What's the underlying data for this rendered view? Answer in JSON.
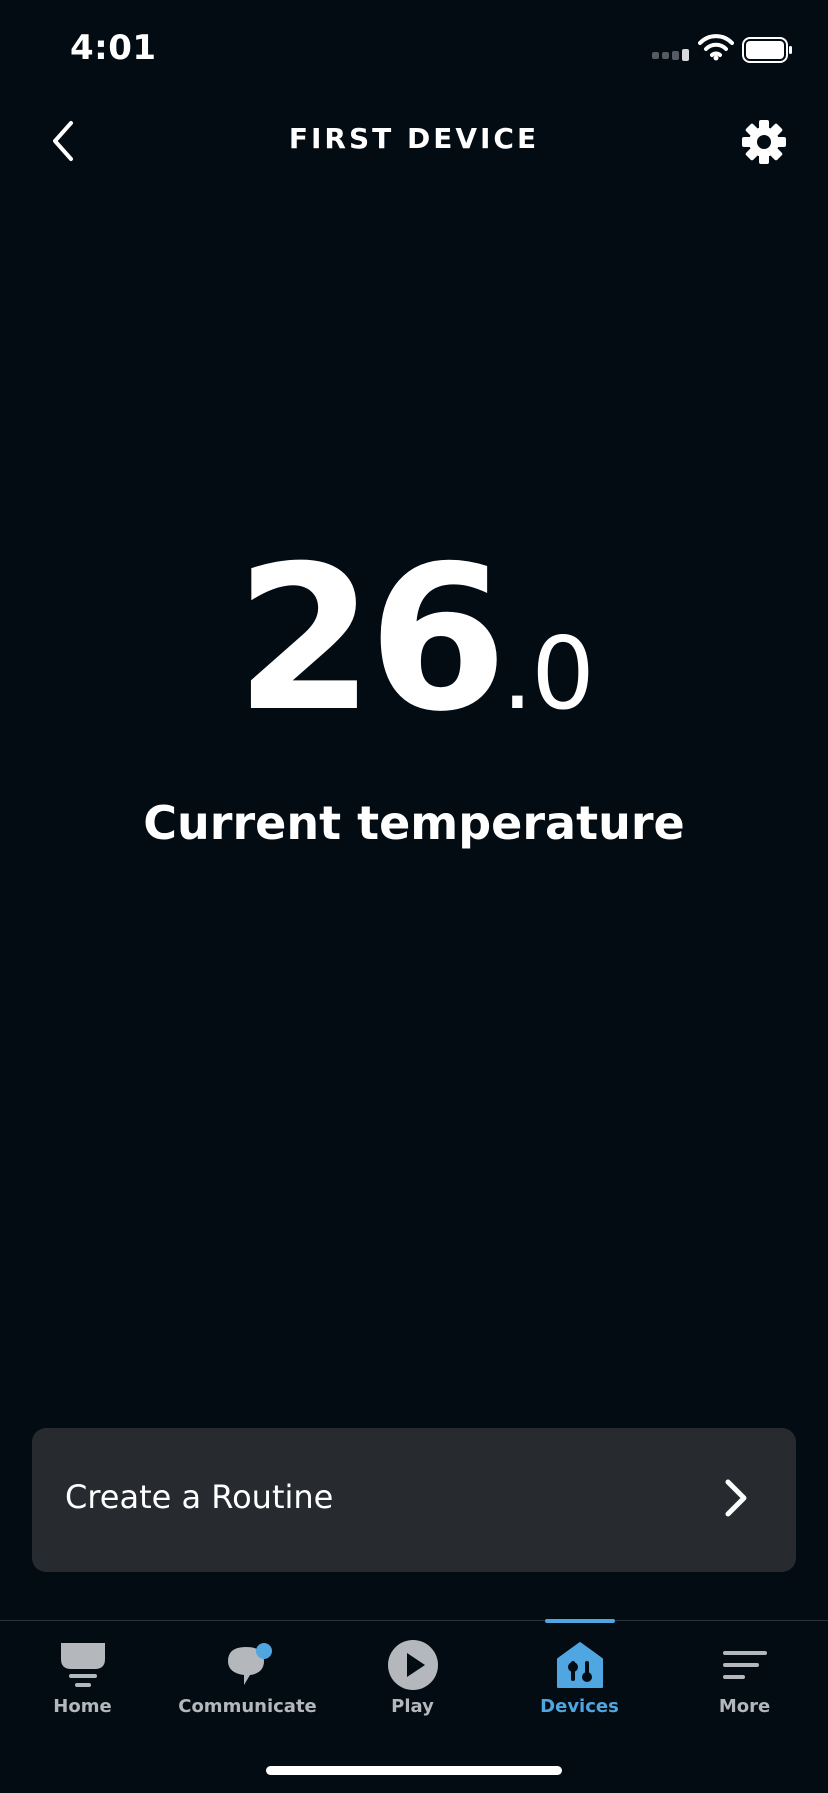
{
  "status_bar": {
    "time": "4:01"
  },
  "header": {
    "title": "FIRST DEVICE",
    "back_icon": "chevron-left-icon",
    "settings_icon": "gear-icon"
  },
  "temperature": {
    "integer": "26",
    "decimal": ".0",
    "label": "Current temperature"
  },
  "routine_card": {
    "label": "Create a Routine",
    "icon": "chevron-right-icon"
  },
  "tabs": [
    {
      "label": "Home",
      "icon": "home-icon",
      "active": false
    },
    {
      "label": "Communicate",
      "icon": "communicate-icon",
      "active": false
    },
    {
      "label": "Play",
      "icon": "play-icon",
      "active": false
    },
    {
      "label": "Devices",
      "icon": "devices-icon",
      "active": true
    },
    {
      "label": "More",
      "icon": "more-menu-icon",
      "active": false
    }
  ],
  "colors": {
    "background": "#030b13",
    "card": "#272b2f",
    "accent": "#4fa6e0",
    "inactive_tab": "#b4b8bd"
  }
}
